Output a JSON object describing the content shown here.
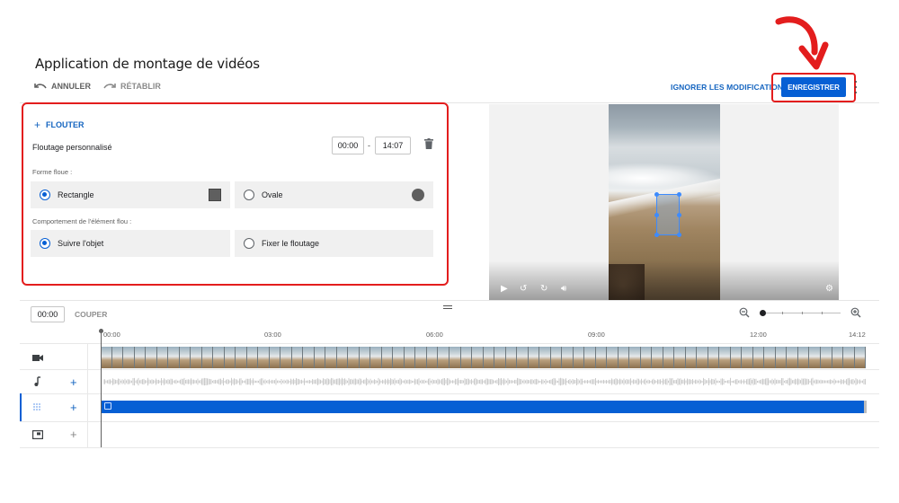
{
  "app": {
    "title": "Application de montage de vidéos"
  },
  "toolbar": {
    "undo_label": "ANNULER",
    "redo_label": "RÉTABLIR",
    "discard_label": "IGNORER LES MODIFICATIONS",
    "save_label": "ENREGISTRER"
  },
  "blur_panel": {
    "add_label": "FLOUTER",
    "custom_blur_label": "Floutage personnalisé",
    "start_time": "00:00",
    "end_time": "14:07",
    "time_separator": "-",
    "shape_section_label": "Forme floue :",
    "shape_options": [
      {
        "label": "Rectangle",
        "selected": true
      },
      {
        "label": "Ovale",
        "selected": false
      }
    ],
    "behavior_section_label": "Comportement de l'élément flou :",
    "behavior_options": [
      {
        "label": "Suivre l'objet",
        "selected": true
      },
      {
        "label": "Fixer le floutage",
        "selected": false
      }
    ]
  },
  "timeline": {
    "current_time": "00:00",
    "split_label": "COUPER",
    "zoom_level": 0.03,
    "ruler": [
      "00:00",
      "03:00",
      "06:00",
      "09:00",
      "12:00",
      "14:12"
    ],
    "tracks": [
      {
        "name": "video",
        "icon": "video-icon"
      },
      {
        "name": "audio",
        "icon": "music-note-icon"
      },
      {
        "name": "blur",
        "icon": "blur-icon"
      },
      {
        "name": "end-screen",
        "icon": "end-screen-icon"
      }
    ]
  },
  "colors": {
    "accent": "#065fd4",
    "annotation": "#e31d1d"
  }
}
